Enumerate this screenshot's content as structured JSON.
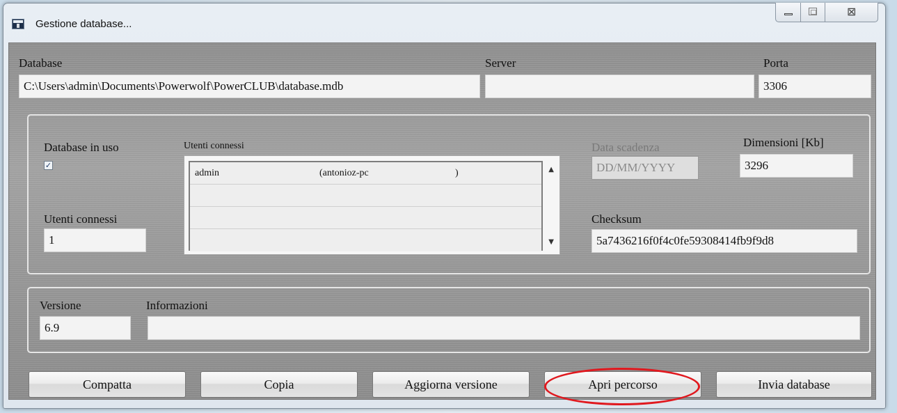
{
  "window": {
    "title": "Gestione database...",
    "caption_buttons": {
      "minimize": "minimize-icon",
      "maximize": "maximize-icon",
      "close": "close-icon"
    }
  },
  "connection": {
    "database_label": "Database",
    "database_value": "C:\\Users\\admin\\Documents\\Powerwolf\\PowerCLUB\\database.mdb",
    "server_label": "Server",
    "server_value": "",
    "port_label": "Porta",
    "port_value": "3306"
  },
  "status": {
    "in_use_label": "Database in uso",
    "in_use_checked": true,
    "connected_users_list_label": "Utenti connessi",
    "connected_users": [
      {
        "user": "admin",
        "host": "(antonioz-pc",
        "close": ")"
      },
      {
        "user": "",
        "host": "",
        "close": ""
      },
      {
        "user": "",
        "host": "",
        "close": ""
      },
      {
        "user": "",
        "host": "",
        "close": ""
      }
    ],
    "connected_users_count_label": "Utenti connessi",
    "connected_users_count": "1",
    "expiry_label": "Data scadenza",
    "expiry_value": "DD/MM/YYYY",
    "size_label": "Dimensioni [Kb]",
    "size_value": "3296",
    "checksum_label": "Checksum",
    "checksum_value": "5a7436216f0f4c0fe59308414fb9f9d8"
  },
  "version_info": {
    "version_label": "Versione",
    "version_value": "6.9",
    "info_label": "Informazioni",
    "info_value": ""
  },
  "buttons": {
    "compact": "Compatta",
    "copy": "Copia",
    "update_version": "Aggiorna versione",
    "open_path": "Apri percorso",
    "send_database": "Invia database"
  },
  "accent_colors": {
    "annotation_ellipse": "#e0191f"
  }
}
